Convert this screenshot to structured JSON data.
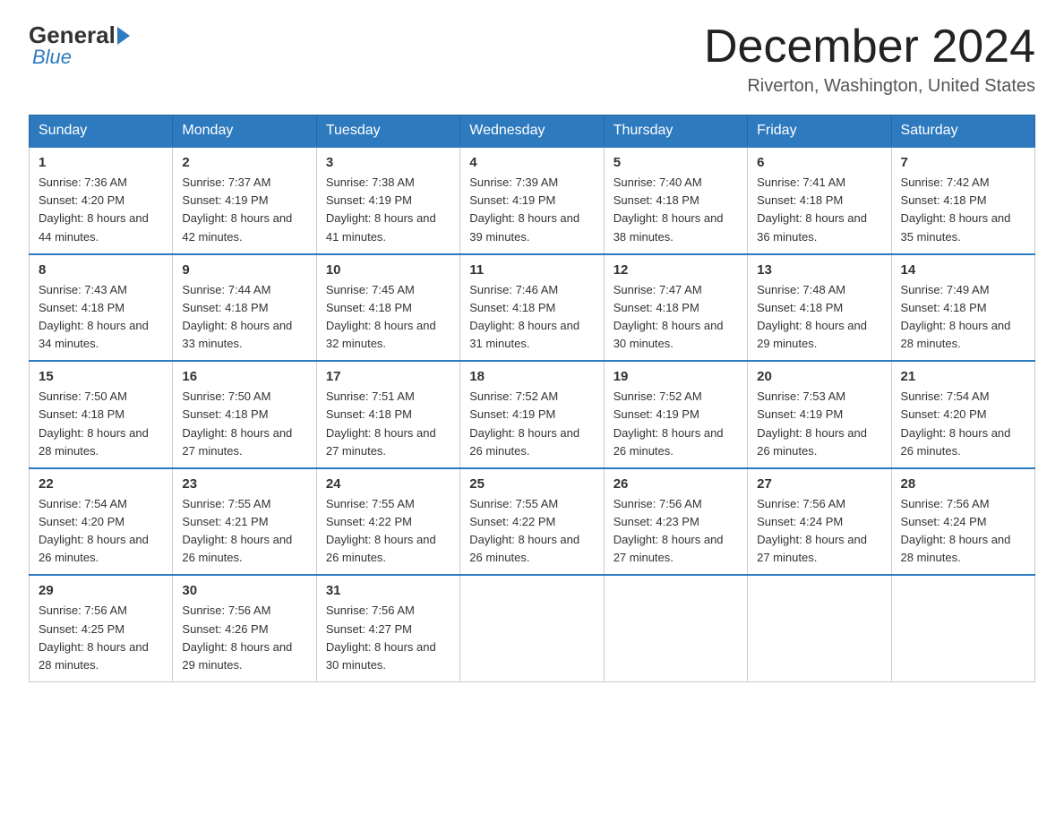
{
  "header": {
    "logo_general": "General",
    "logo_blue": "Blue",
    "month_title": "December 2024",
    "location": "Riverton, Washington, United States"
  },
  "weekdays": [
    "Sunday",
    "Monday",
    "Tuesday",
    "Wednesday",
    "Thursday",
    "Friday",
    "Saturday"
  ],
  "weeks": [
    [
      {
        "day": "1",
        "sunrise": "7:36 AM",
        "sunset": "4:20 PM",
        "daylight": "8 hours and 44 minutes."
      },
      {
        "day": "2",
        "sunrise": "7:37 AM",
        "sunset": "4:19 PM",
        "daylight": "8 hours and 42 minutes."
      },
      {
        "day": "3",
        "sunrise": "7:38 AM",
        "sunset": "4:19 PM",
        "daylight": "8 hours and 41 minutes."
      },
      {
        "day": "4",
        "sunrise": "7:39 AM",
        "sunset": "4:19 PM",
        "daylight": "8 hours and 39 minutes."
      },
      {
        "day": "5",
        "sunrise": "7:40 AM",
        "sunset": "4:18 PM",
        "daylight": "8 hours and 38 minutes."
      },
      {
        "day": "6",
        "sunrise": "7:41 AM",
        "sunset": "4:18 PM",
        "daylight": "8 hours and 36 minutes."
      },
      {
        "day": "7",
        "sunrise": "7:42 AM",
        "sunset": "4:18 PM",
        "daylight": "8 hours and 35 minutes."
      }
    ],
    [
      {
        "day": "8",
        "sunrise": "7:43 AM",
        "sunset": "4:18 PM",
        "daylight": "8 hours and 34 minutes."
      },
      {
        "day": "9",
        "sunrise": "7:44 AM",
        "sunset": "4:18 PM",
        "daylight": "8 hours and 33 minutes."
      },
      {
        "day": "10",
        "sunrise": "7:45 AM",
        "sunset": "4:18 PM",
        "daylight": "8 hours and 32 minutes."
      },
      {
        "day": "11",
        "sunrise": "7:46 AM",
        "sunset": "4:18 PM",
        "daylight": "8 hours and 31 minutes."
      },
      {
        "day": "12",
        "sunrise": "7:47 AM",
        "sunset": "4:18 PM",
        "daylight": "8 hours and 30 minutes."
      },
      {
        "day": "13",
        "sunrise": "7:48 AM",
        "sunset": "4:18 PM",
        "daylight": "8 hours and 29 minutes."
      },
      {
        "day": "14",
        "sunrise": "7:49 AM",
        "sunset": "4:18 PM",
        "daylight": "8 hours and 28 minutes."
      }
    ],
    [
      {
        "day": "15",
        "sunrise": "7:50 AM",
        "sunset": "4:18 PM",
        "daylight": "8 hours and 28 minutes."
      },
      {
        "day": "16",
        "sunrise": "7:50 AM",
        "sunset": "4:18 PM",
        "daylight": "8 hours and 27 minutes."
      },
      {
        "day": "17",
        "sunrise": "7:51 AM",
        "sunset": "4:18 PM",
        "daylight": "8 hours and 27 minutes."
      },
      {
        "day": "18",
        "sunrise": "7:52 AM",
        "sunset": "4:19 PM",
        "daylight": "8 hours and 26 minutes."
      },
      {
        "day": "19",
        "sunrise": "7:52 AM",
        "sunset": "4:19 PM",
        "daylight": "8 hours and 26 minutes."
      },
      {
        "day": "20",
        "sunrise": "7:53 AM",
        "sunset": "4:19 PM",
        "daylight": "8 hours and 26 minutes."
      },
      {
        "day": "21",
        "sunrise": "7:54 AM",
        "sunset": "4:20 PM",
        "daylight": "8 hours and 26 minutes."
      }
    ],
    [
      {
        "day": "22",
        "sunrise": "7:54 AM",
        "sunset": "4:20 PM",
        "daylight": "8 hours and 26 minutes."
      },
      {
        "day": "23",
        "sunrise": "7:55 AM",
        "sunset": "4:21 PM",
        "daylight": "8 hours and 26 minutes."
      },
      {
        "day": "24",
        "sunrise": "7:55 AM",
        "sunset": "4:22 PM",
        "daylight": "8 hours and 26 minutes."
      },
      {
        "day": "25",
        "sunrise": "7:55 AM",
        "sunset": "4:22 PM",
        "daylight": "8 hours and 26 minutes."
      },
      {
        "day": "26",
        "sunrise": "7:56 AM",
        "sunset": "4:23 PM",
        "daylight": "8 hours and 27 minutes."
      },
      {
        "day": "27",
        "sunrise": "7:56 AM",
        "sunset": "4:24 PM",
        "daylight": "8 hours and 27 minutes."
      },
      {
        "day": "28",
        "sunrise": "7:56 AM",
        "sunset": "4:24 PM",
        "daylight": "8 hours and 28 minutes."
      }
    ],
    [
      {
        "day": "29",
        "sunrise": "7:56 AM",
        "sunset": "4:25 PM",
        "daylight": "8 hours and 28 minutes."
      },
      {
        "day": "30",
        "sunrise": "7:56 AM",
        "sunset": "4:26 PM",
        "daylight": "8 hours and 29 minutes."
      },
      {
        "day": "31",
        "sunrise": "7:56 AM",
        "sunset": "4:27 PM",
        "daylight": "8 hours and 30 minutes."
      },
      null,
      null,
      null,
      null
    ]
  ]
}
